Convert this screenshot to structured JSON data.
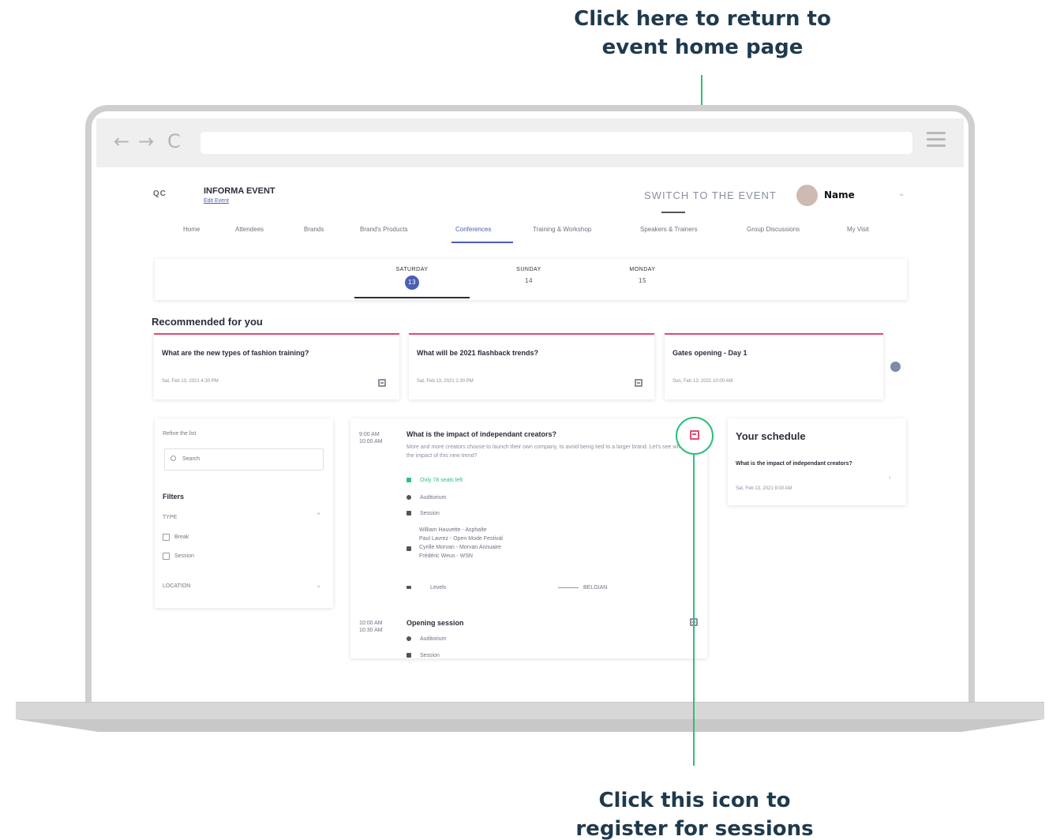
{
  "callouts": {
    "top_line1": "Click here to return to",
    "top_line2": "event home page",
    "bottom_line1": "Click this icon to",
    "bottom_line2": "register for sessions"
  },
  "browser": {
    "back": "←",
    "forward": "→",
    "reload": "C"
  },
  "header": {
    "logo": "QC",
    "event_name": "INFORMA EVENT",
    "edit_link": "Edit Event",
    "switch_button": "SWITCH TO THE EVENT",
    "user_name": "Name",
    "user_chevron": "⌄"
  },
  "tabs": [
    {
      "label": "Home"
    },
    {
      "label": "Attendees"
    },
    {
      "label": "Brands"
    },
    {
      "label": "Brand's Products"
    },
    {
      "label": "Conferences"
    },
    {
      "label": "Training & Workshop"
    },
    {
      "label": "Speakers & Trainers"
    },
    {
      "label": "Group Discussions"
    },
    {
      "label": "My Visit"
    }
  ],
  "days": [
    {
      "name": "SATURDAY",
      "num": "13"
    },
    {
      "name": "SUNDAY",
      "num": "14"
    },
    {
      "name": "MONDAY",
      "num": "15"
    }
  ],
  "recommended": {
    "title": "Recommended for you",
    "cards": [
      {
        "title": "What are the new types of fashion training?",
        "date": "Sat, Feb 13, 2021 4:30 PM"
      },
      {
        "title": "What will be 2021 flashback trends?",
        "date": "Sat, Feb 13, 2021 1:30 PM"
      },
      {
        "title": "Gates opening - Day 1",
        "date": "Sun, Feb 13, 2021 10:00 AM"
      }
    ]
  },
  "filters": {
    "refine": "Refine the list",
    "search_placeholder": "Search",
    "title": "Filters",
    "type_label": "TYPE",
    "options": [
      "Break",
      "Session"
    ],
    "location_label": "LOCATION",
    "chevron": "⌄"
  },
  "sessions": [
    {
      "time_start": "9:00 AM",
      "time_end": "10:00 AM",
      "title": "What is the impact of independant creators?",
      "description": "More and more creators choose to launch their own company, to avoid being tied to a larger brand. Let's see what is the impact of this new trend?",
      "seats": "Only 78 seats left",
      "location": "Auditorium",
      "type": "Session",
      "speakers": [
        "William Hauvette - Asphalte",
        "Paul Lavrez - Open Mode Festival",
        "Cyrille Morvan - Morvan Annuaire",
        "Frédéric Weus - WSN"
      ],
      "level": "Levels",
      "language": "BELGIAN"
    },
    {
      "time_start": "10:00 AM",
      "time_end": "10:30 AM",
      "title": "Opening session",
      "location": "Auditorium",
      "type": "Session"
    }
  ],
  "schedule": {
    "title": "Your schedule",
    "item": "What is the impact of independant creators?",
    "date": "Sat, Feb 13, 2021 9:00 AM",
    "chevron": "›"
  },
  "colors": {
    "accent": "#4a5fb3",
    "callout_line": "#2cc079",
    "card_top": "#e14b73",
    "callout_text": "#1f3a4d"
  }
}
